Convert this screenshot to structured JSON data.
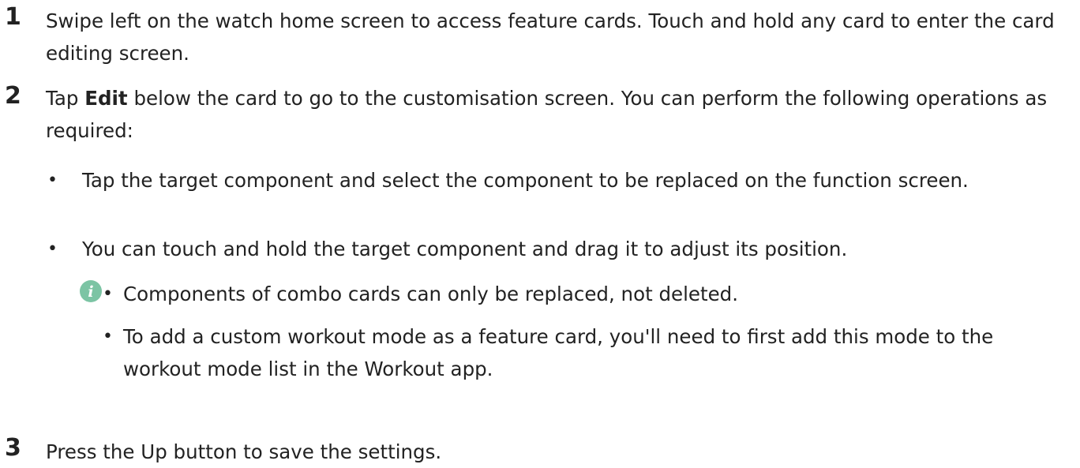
{
  "steps": [
    {
      "number": "1",
      "text": "Swipe left on the watch home screen to access feature cards. Touch and hold any card to enter the card editing screen."
    },
    {
      "number": "2",
      "text_before": "Tap ",
      "text_bold": "Edit",
      "text_after": " below the card to go to the customisation screen. You can perform the following operations as required:",
      "bullets": [
        "Tap the target component and select the component to be replaced on the function screen.",
        "You can touch and hold the target component and drag it to adjust its position."
      ],
      "note": {
        "icon": "info-icon",
        "items": [
          "Components of combo cards can only be replaced, not deleted.",
          "To add a custom workout mode as a feature card, you'll need to first add this mode to the workout mode list in the Workout app."
        ]
      }
    },
    {
      "number": "3",
      "text": "Press the Up button to save the settings."
    }
  ],
  "bullet_char": "•",
  "colors": {
    "text": "#222222",
    "note_icon": "#7cc4a4"
  }
}
